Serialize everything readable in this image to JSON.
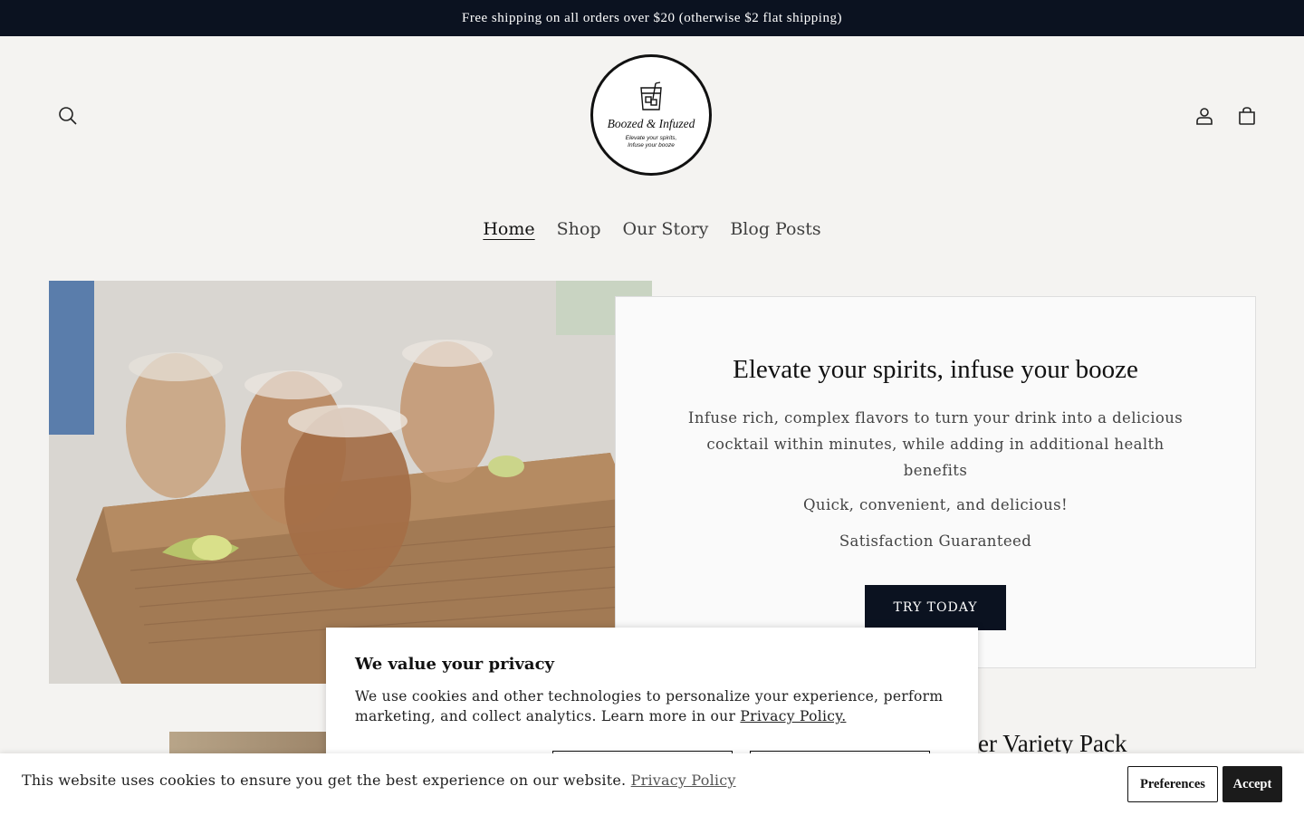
{
  "announcement": "Free shipping on all orders over $20 (otherwise $2 flat shipping)",
  "header": {
    "search_icon": "search-icon",
    "account_icon": "user-icon",
    "cart_icon": "cart-icon",
    "logo": {
      "name": "Boozed & Infuzed",
      "tagline": "Elevate your spirits, Infuse your booze"
    }
  },
  "nav": {
    "items": [
      {
        "label": "Home",
        "active": true
      },
      {
        "label": "Shop"
      },
      {
        "label": "Our Story"
      },
      {
        "label": "Blog Posts"
      }
    ]
  },
  "hero": {
    "title": "Elevate your spirits, infuse your booze",
    "text": "Infuse rich, complex flavors to turn your drink into a delicious cocktail within minutes, while adding in additional health benefits",
    "line1": "Quick, convenient, and delicious!",
    "line2": "Satisfaction Guaranteed",
    "cta": "TRY TODAY"
  },
  "product_partial_title": "er Variety Pack",
  "privacy_modal": {
    "title": "We value your privacy",
    "body": "We use cookies and other technologies to personalize your experience, perform marketing, and collect analytics. Learn more in our",
    "link": "Privacy Policy."
  },
  "cookie_bar": {
    "text": "This website uses cookies to ensure you get the best experience on our website.",
    "link": "Privacy Policy",
    "preferences": "Preferences",
    "accept": "Accept"
  },
  "colors": {
    "announcement_bg": "#0b1220",
    "page_bg": "#f4f3f1",
    "cta_bg": "#0b1220"
  }
}
